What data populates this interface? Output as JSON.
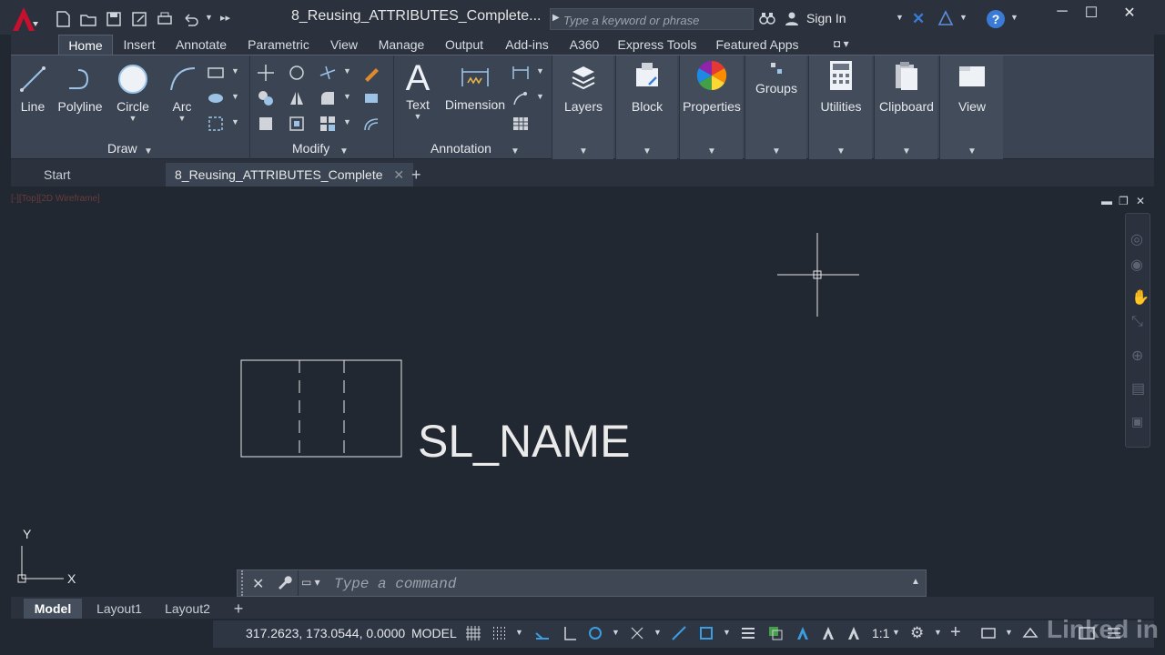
{
  "window": {
    "document_title": "8_Reusing_ATTRIBUTES_Complete...",
    "search_placeholder": "Type a keyword or phrase",
    "signin_label": "Sign In"
  },
  "ribbon": {
    "tabs": [
      "Home",
      "Insert",
      "Annotate",
      "Parametric",
      "View",
      "Manage",
      "Output",
      "Add-ins",
      "A360",
      "Express Tools",
      "Featured Apps"
    ],
    "active_tab": "Home",
    "draw_tools": [
      "Line",
      "Polyline",
      "Circle",
      "Arc"
    ],
    "draw_panel": "Draw",
    "modify_panel": "Modify",
    "annotation_tools": [
      "Text",
      "Dimension"
    ],
    "annotation_panel": "Annotation",
    "big_panels": [
      "Layers",
      "Block",
      "Properties",
      "Groups",
      "Utilities",
      "Clipboard",
      "View"
    ]
  },
  "doc_tabs": {
    "start": "Start",
    "active": "8_Reusing_ATTRIBUTES_Complete"
  },
  "canvas": {
    "viewport_label": "[-][Top][2D Wireframe]",
    "drawing_text": "SL_NAME",
    "ucs_y": "Y",
    "ucs_x": "X"
  },
  "command_line": {
    "placeholder": "Type a command"
  },
  "layout_tabs": [
    "Model",
    "Layout1",
    "Layout2"
  ],
  "status_bar": {
    "coordinates": "317.2623, 173.0544, 0.0000",
    "model_label": "MODEL",
    "scale": "1:1"
  },
  "watermark": "Linked in",
  "colors": {
    "accent_red": "#c8102e",
    "canvas_bg": "#212831",
    "ribbon_bg": "#3b4452"
  }
}
